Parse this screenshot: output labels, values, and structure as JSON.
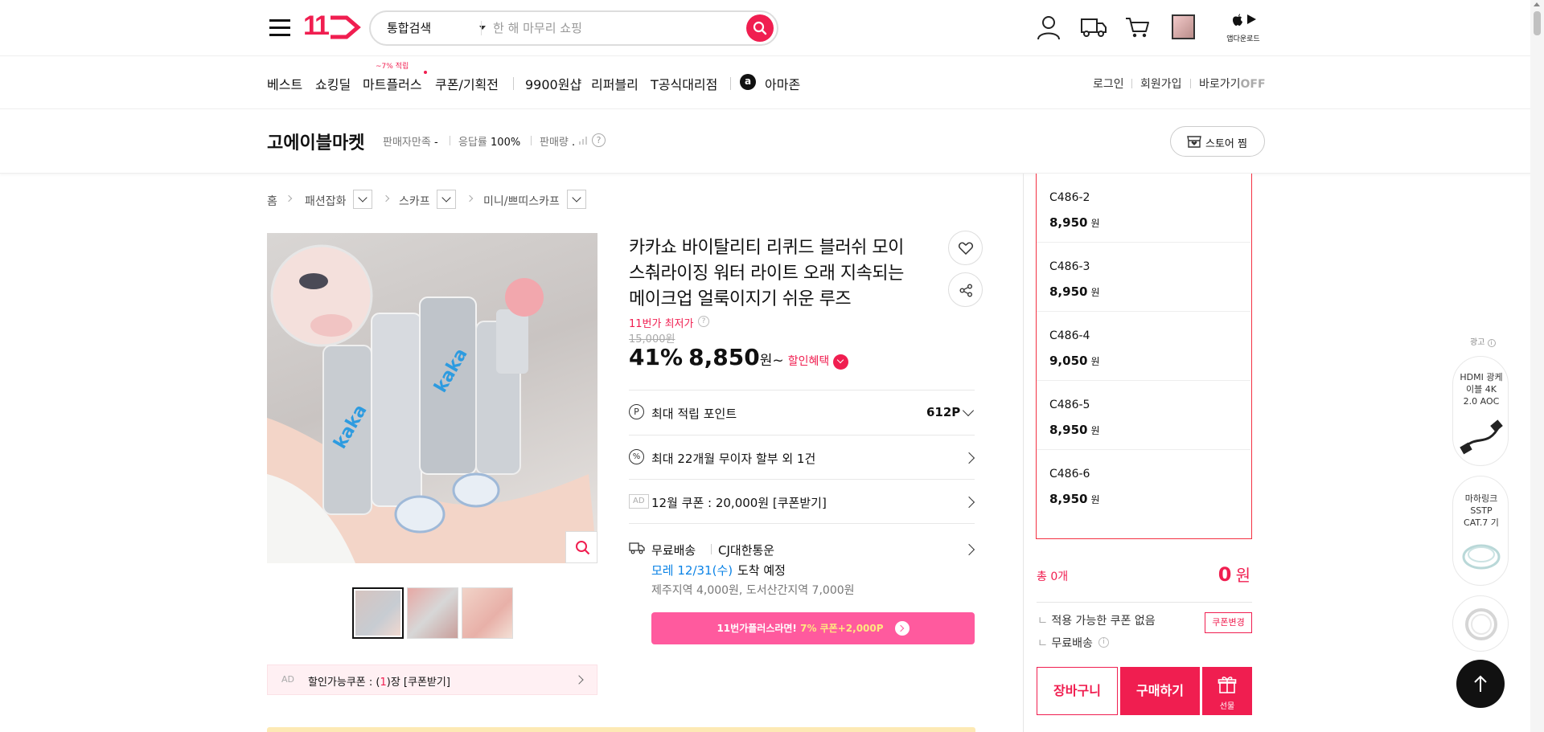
{
  "header": {
    "logo_text": "11",
    "search": {
      "category": "통합검색",
      "placeholder": "한 해 마무리 쇼핑"
    },
    "app_download": "앱다운로드"
  },
  "gnb": {
    "items": [
      "베스트",
      "쇼킹딜",
      "마트플러스",
      "쿠폰/기획전",
      "9900원샵",
      "리퍼블리",
      "T공식대리점",
      "아마존"
    ],
    "mart_badge": "~7% 적립",
    "util": {
      "login": "로그인",
      "join": "회원가입",
      "shortcut": "바로가기",
      "shortcut_state": "OFF"
    }
  },
  "seller": {
    "name": "고에이블마켓",
    "satisfaction_label": "판매자만족",
    "satisfaction_value": "-",
    "response_label": "응답률",
    "response_value": "100%",
    "sales_label": "판매량",
    "sales_value": ".",
    "store_button": "스토어 찜"
  },
  "breadcrumb": [
    "홈",
    "패션잡화",
    "스카프",
    "미니/쁘띠스카프"
  ],
  "product": {
    "title_lines": [
      "카카쇼 바이탈리티 리퀴드 블러쉬 모이",
      "스춰라이징 워터 라이트 오래 지속되는",
      "메이크업 얼룩이지기 쉬운 루즈"
    ],
    "lowest_label": "11번가 최저가",
    "original_price": "15,000원",
    "discount": "41%",
    "price": "8,850",
    "price_unit": "원~",
    "benefit": "할인혜택",
    "point_label": "최대 적립 포인트",
    "point_value": "612P",
    "installment": "최대 22개월 무이자 할부 외 1건",
    "ad_tag": "AD",
    "coupon": "12월 쿠폰 : 20,000원 [쿠폰받기]",
    "delivery_label": "무료배송",
    "courier": "CJ대한통운",
    "arrival_date": "모레 12/31(수)",
    "arrival_suffix": "도착 예정",
    "extra_fee": "제주지역 4,000원, 도서산간지역 7,000원",
    "plus_banner_prefix": "11번가플러스라면!",
    "plus_banner_highlight": "7% 쿠폰+2,000P"
  },
  "left_coupon": {
    "ad_tag": "AD",
    "prefix": "할인가능쿠폰 : (",
    "count": "1",
    "suffix": ")장 [쿠폰받기]"
  },
  "options": [
    {
      "name": "C486-2",
      "price": "8,950",
      "unit": "원"
    },
    {
      "name": "C486-3",
      "price": "8,950",
      "unit": "원"
    },
    {
      "name": "C486-4",
      "price": "9,050",
      "unit": "원"
    },
    {
      "name": "C486-5",
      "price": "8,950",
      "unit": "원"
    },
    {
      "name": "C486-6",
      "price": "8,950",
      "unit": "원"
    }
  ],
  "summary": {
    "total_label": "총 0개",
    "total_value": "0",
    "total_unit": "원",
    "coupon_none": "적용 가능한 쿠폰 없음",
    "coupon_change": "쿠폰변경",
    "free_delivery": "무료배송",
    "cart_button": "장바구니",
    "buy_button": "구매하기",
    "gift_button": "선물"
  },
  "side_ads": {
    "label": "광고",
    "items": [
      {
        "text": "HDMI 광케이블 4K 2.0 AOC"
      },
      {
        "text": "마하링크 SSTP CAT.7 기"
      }
    ]
  },
  "colors": {
    "brand": "#f01e50",
    "accent": "#f43142",
    "link_blue": "#0b83e6",
    "plus_pink": "#ff5a9e"
  }
}
